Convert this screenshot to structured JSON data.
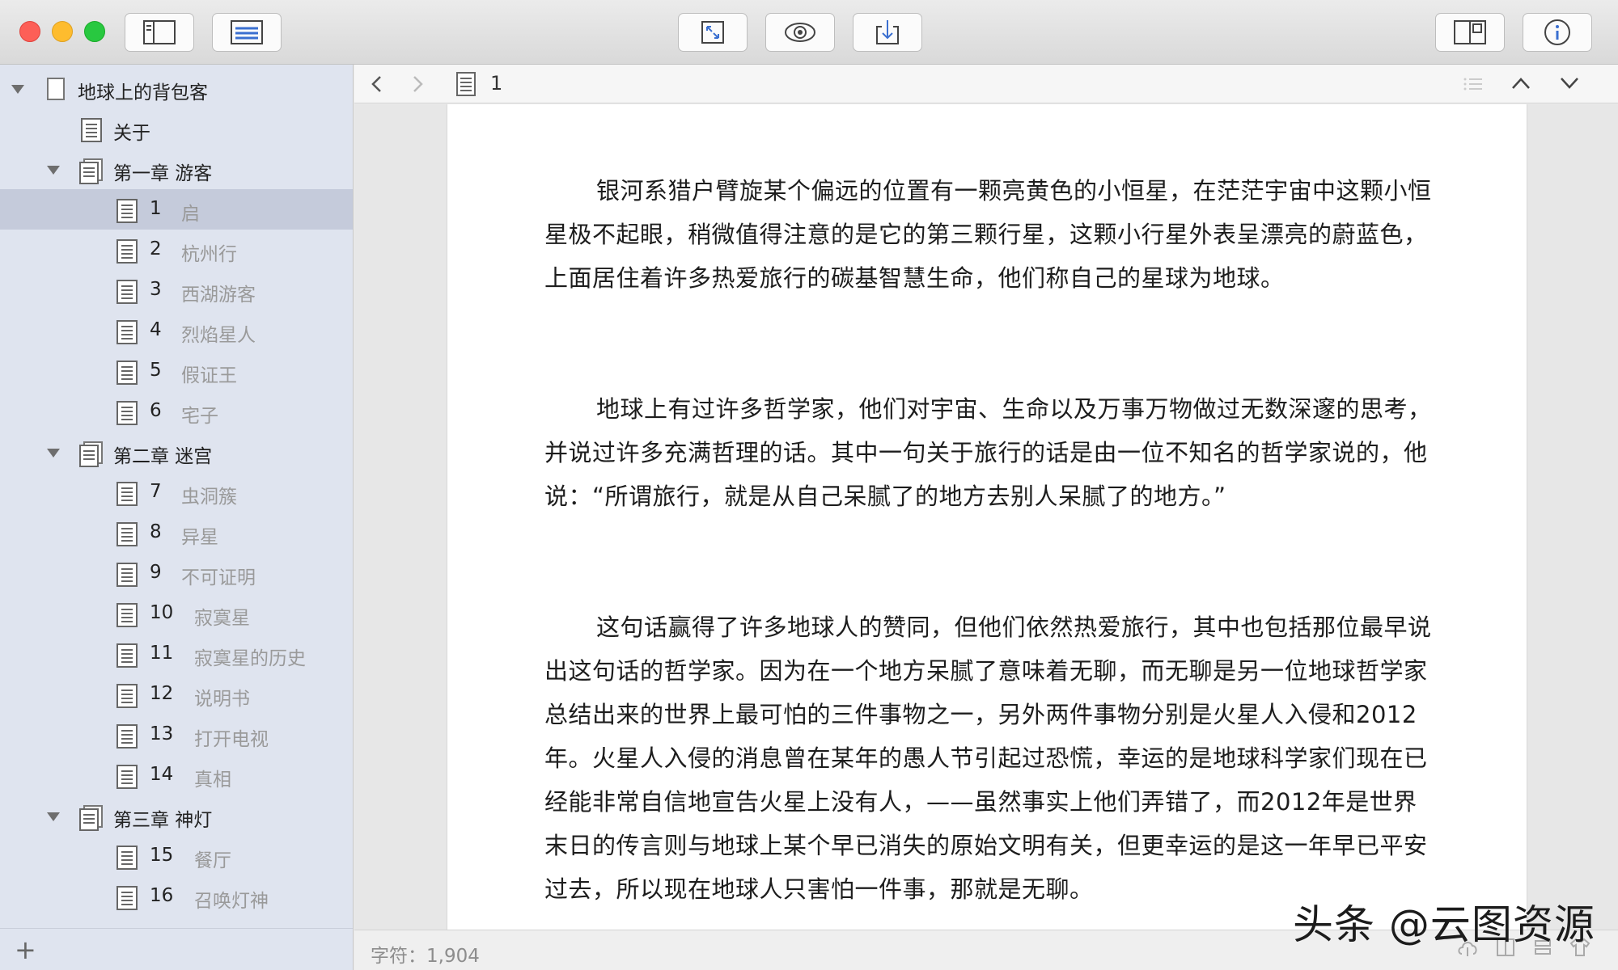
{
  "toolbar": {
    "icons": [
      "sidebar-toggle-icon",
      "list-view-icon",
      "expand-icon",
      "preview-eye-icon",
      "export-download-icon",
      "split-view-icon",
      "info-icon"
    ]
  },
  "sidebar": {
    "root": "地球上的背包客",
    "items": [
      {
        "type": "doc",
        "num": "",
        "label": "关于"
      },
      {
        "type": "folder",
        "num": "",
        "label": "第一章 游客"
      },
      {
        "type": "doc",
        "num": "1",
        "label": "启",
        "selected": true
      },
      {
        "type": "doc",
        "num": "2",
        "label": "杭州行"
      },
      {
        "type": "doc",
        "num": "3",
        "label": "西湖游客"
      },
      {
        "type": "doc",
        "num": "4",
        "label": "烈焰星人"
      },
      {
        "type": "doc",
        "num": "5",
        "label": "假证王"
      },
      {
        "type": "doc",
        "num": "6",
        "label": "宅子"
      },
      {
        "type": "folder",
        "num": "",
        "label": "第二章 迷宫"
      },
      {
        "type": "doc",
        "num": "7",
        "label": "虫洞簇"
      },
      {
        "type": "doc",
        "num": "8",
        "label": "异星"
      },
      {
        "type": "doc",
        "num": "9",
        "label": "不可证明"
      },
      {
        "type": "doc",
        "num": "10",
        "label": "寂寞星"
      },
      {
        "type": "doc",
        "num": "11",
        "label": "寂寞星的历史"
      },
      {
        "type": "doc",
        "num": "12",
        "label": "说明书"
      },
      {
        "type": "doc",
        "num": "13",
        "label": "打开电视"
      },
      {
        "type": "doc",
        "num": "14",
        "label": "真相"
      },
      {
        "type": "folder",
        "num": "",
        "label": "第三章 神灯"
      },
      {
        "type": "doc",
        "num": "15",
        "label": "餐厅"
      },
      {
        "type": "doc",
        "num": "16",
        "label": "召唤灯神"
      }
    ],
    "add_label": "+"
  },
  "navbar": {
    "back": "<",
    "forward": ">",
    "doc_title": "1"
  },
  "document": {
    "paragraphs": [
      "银河系猎户臂旋某个偏远的位置有一颗亮黄色的小恒星，在茫茫宇宙中这颗小恒星极不起眼，稍微值得注意的是它的第三颗行星，这颗小行星外表呈漂亮的蔚蓝色，上面居住着许多热爱旅行的碳基智慧生命，他们称自己的星球为地球。",
      "地球上有过许多哲学家，他们对宇宙、生命以及万事万物做过无数深邃的思考，并说过许多充满哲理的话。其中一句关于旅行的话是由一位不知名的哲学家说的，他说：“所谓旅行，就是从自己呆腻了的地方去别人呆腻了的地方。”",
      "这句话赢得了许多地球人的赞同，但他们依然热爱旅行，其中也包括那位最早说出这句话的哲学家。因为在一个地方呆腻了意味着无聊，而无聊是另一位地球哲学家总结出来的世界上最可怕的三件事物之一，另外两件事物分别是火星人入侵和2012年。火星人入侵的消息曾在某年的愚人节引起过恐慌，幸运的是地球科学家们现在已经能非常自信地宣告火星上没有人，——虽然事实上他们弄错了，而2012年是世界末日的传言则与地球上某个早已消失的原始文明有关，但更幸运的是这一年早已平安过去，所以现在地球人只害怕一件事，那就是无聊。"
    ]
  },
  "status": {
    "char_count": "字符：1,904"
  },
  "watermark": "头条 @云图资源",
  "colors": {
    "sidebar_bg": "#dfe4ef",
    "selected_row": "#c5cbdb",
    "traffic_red": "#fd5f57",
    "traffic_yellow": "#febc2e",
    "traffic_green": "#28c840"
  }
}
